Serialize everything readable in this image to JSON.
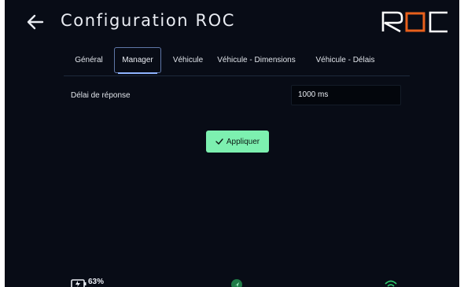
{
  "header": {
    "title": "Configuration ROC",
    "logo_text": "ROC"
  },
  "tabs": [
    {
      "label": "Général"
    },
    {
      "label": "Manager"
    },
    {
      "label": "Véhicule"
    },
    {
      "label": "Véhicule - Dimensions"
    },
    {
      "label": "Véhicule - Délais"
    }
  ],
  "active_tab": "Manager",
  "form": {
    "response_delay_label": "Délai de réponse",
    "response_delay_value": "1000 ms"
  },
  "apply_button": {
    "label": "Appliquer",
    "color": "#7df0b0"
  },
  "status": {
    "battery": "63%"
  },
  "colors": {
    "background": "#080c16",
    "accent_logo": "#e8601c",
    "status_green": "#2ec46a"
  }
}
